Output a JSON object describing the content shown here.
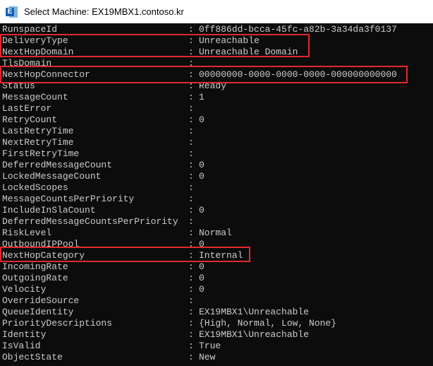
{
  "window": {
    "title": "Select Machine: EX19MBX1.contoso.kr",
    "icon": "powershell-icon",
    "app_icon_letter": "E"
  },
  "console": {
    "separator": ":",
    "text_color": "#cccccc",
    "background": "#0c0c0c",
    "highlight_color": "#e0282e",
    "rows": [
      {
        "name": "RunspaceId",
        "value": "0ff886dd-bcca-45fc-a82b-3a34da3f0137"
      },
      {
        "name": "DeliveryType",
        "value": "Unreachable"
      },
      {
        "name": "NextHopDomain",
        "value": "Unreachable Domain"
      },
      {
        "name": "TlsDomain",
        "value": ""
      },
      {
        "name": "NextHopConnector",
        "value": "00000000-0000-0000-0000-000000000000"
      },
      {
        "name": "Status",
        "value": "Ready"
      },
      {
        "name": "MessageCount",
        "value": "1"
      },
      {
        "name": "LastError",
        "value": ""
      },
      {
        "name": "RetryCount",
        "value": "0"
      },
      {
        "name": "LastRetryTime",
        "value": ""
      },
      {
        "name": "NextRetryTime",
        "value": ""
      },
      {
        "name": "FirstRetryTime",
        "value": ""
      },
      {
        "name": "DeferredMessageCount",
        "value": "0"
      },
      {
        "name": "LockedMessageCount",
        "value": "0"
      },
      {
        "name": "LockedScopes",
        "value": ""
      },
      {
        "name": "MessageCountsPerPriority",
        "value": ""
      },
      {
        "name": "IncludeInSlaCount",
        "value": "0"
      },
      {
        "name": "DeferredMessageCountsPerPriority",
        "value": ""
      },
      {
        "name": "RiskLevel",
        "value": "Normal"
      },
      {
        "name": "OutboundIPPool",
        "value": "0"
      },
      {
        "name": "NextHopCategory",
        "value": "Internal"
      },
      {
        "name": "IncomingRate",
        "value": "0"
      },
      {
        "name": "OutgoingRate",
        "value": "0"
      },
      {
        "name": "Velocity",
        "value": "0"
      },
      {
        "name": "OverrideSource",
        "value": ""
      },
      {
        "name": "QueueIdentity",
        "value": "EX19MBX1\\Unreachable"
      },
      {
        "name": "PriorityDescriptions",
        "value": "{High, Normal, Low, None}"
      },
      {
        "name": "Identity",
        "value": "EX19MBX1\\Unreachable"
      },
      {
        "name": "IsValid",
        "value": "True"
      },
      {
        "name": "ObjectState",
        "value": "New"
      }
    ]
  }
}
